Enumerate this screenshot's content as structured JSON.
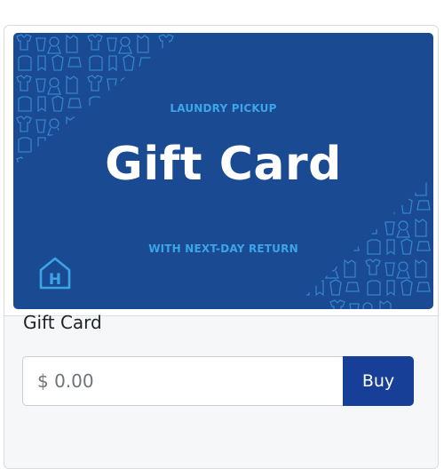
{
  "gift_card_image": {
    "eyebrow": "LAUNDRY PICKUP",
    "title": "Gift Card",
    "subline": "WITH NEXT-DAY RETURN",
    "logo_letter": "H",
    "background_color": "#1a4a91",
    "accent_color": "#3ca5e8"
  },
  "product": {
    "title": "Gift Card"
  },
  "purchase": {
    "amount_placeholder": "$ 0.00",
    "buy_label": "Buy",
    "button_color": "#173f97"
  },
  "icons": [
    "clothing-pattern-icon",
    "house-logo-icon"
  ]
}
